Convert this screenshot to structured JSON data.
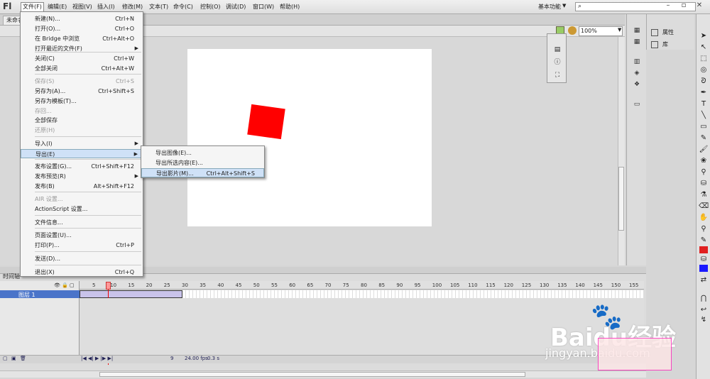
{
  "app": {
    "logo": "Fl"
  },
  "menubar": {
    "items": [
      "文件(F)",
      "编辑(E)",
      "视图(V)",
      "插入(I)",
      "修改(M)",
      "文本(T)",
      "命令(C)",
      "控制(O)",
      "调试(D)",
      "窗口(W)",
      "帮助(H)"
    ],
    "workspace": "基本功能",
    "search_placeholder": ""
  },
  "document": {
    "tab": "未命名"
  },
  "editbar": {
    "zoom": "100%"
  },
  "file_menu": [
    {
      "label": "新建(N)...",
      "shortcut": "Ctrl+N"
    },
    {
      "label": "打开(O)...",
      "shortcut": "Ctrl+O"
    },
    {
      "label": "在 Bridge 中浏览",
      "shortcut": "Ctrl+Alt+O"
    },
    {
      "label": "打开最近的文件(F)",
      "shortcut": ""
    },
    {
      "label": "关闭(C)",
      "shortcut": "Ctrl+W"
    },
    {
      "label": "全部关闭",
      "shortcut": "Ctrl+Alt+W"
    },
    {
      "label": "保存(S)",
      "shortcut": "Ctrl+S"
    },
    {
      "label": "另存为(A)...",
      "shortcut": "Ctrl+Shift+S"
    },
    {
      "label": "另存为模板(T)...",
      "shortcut": ""
    },
    {
      "label": "存回...",
      "shortcut": ""
    },
    {
      "label": "全部保存",
      "shortcut": ""
    },
    {
      "label": "还原(H)",
      "shortcut": ""
    },
    {
      "label": "导入(I)",
      "shortcut": ""
    },
    {
      "label": "导出(E)",
      "shortcut": ""
    },
    {
      "label": "发布设置(G)...",
      "shortcut": "Ctrl+Shift+F12"
    },
    {
      "label": "发布预览(R)",
      "shortcut": ""
    },
    {
      "label": "发布(B)",
      "shortcut": "Alt+Shift+F12"
    },
    {
      "label": "AIR 设置...",
      "shortcut": ""
    },
    {
      "label": "ActionScript 设置...",
      "shortcut": ""
    },
    {
      "label": "文件信息...",
      "shortcut": ""
    },
    {
      "label": "页面设置(U)...",
      "shortcut": ""
    },
    {
      "label": "打印(P)...",
      "shortcut": "Ctrl+P"
    },
    {
      "label": "发送(D)...",
      "shortcut": ""
    },
    {
      "label": "退出(X)",
      "shortcut": "Ctrl+Q"
    }
  ],
  "export_submenu": [
    {
      "label": "导出图像(E)...",
      "shortcut": ""
    },
    {
      "label": "导出所选内容(E)...",
      "shortcut": ""
    },
    {
      "label": "导出影片(M)...",
      "shortcut": "Ctrl+Alt+Shift+S"
    }
  ],
  "panels": {
    "properties": "属性",
    "library": "库"
  },
  "timeline": {
    "tab": "时间轴",
    "layer_name": "图层 1",
    "frame_numbers": [
      "5",
      "10",
      "15",
      "20",
      "25",
      "30",
      "35",
      "40",
      "45",
      "50",
      "55",
      "60",
      "65",
      "70",
      "75",
      "80",
      "85",
      "90",
      "95",
      "100",
      "105",
      "110",
      "115",
      "120",
      "125",
      "130",
      "135",
      "140",
      "145",
      "150",
      "155"
    ],
    "current_frame": "9",
    "fps": "24.00 fps",
    "time": "0.3 s"
  },
  "colors": {
    "stroke": "#e02020",
    "fill": "#1a1aff",
    "shape": "#ff0000"
  },
  "watermark": {
    "brand": "Baidu",
    "brand_cn": "经验",
    "url": "jingyan.baidu.com"
  }
}
